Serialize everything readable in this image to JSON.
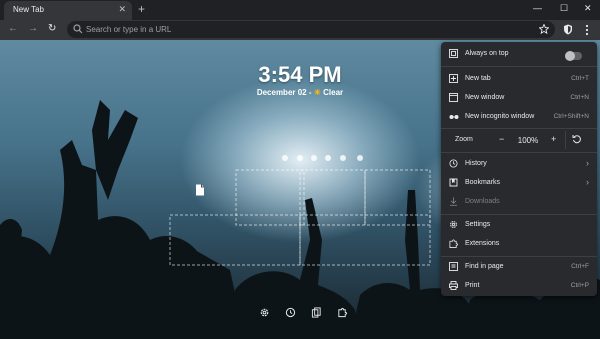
{
  "tab": {
    "title": "New Tab",
    "close": "✕"
  },
  "new_tab_button": "+",
  "window": {
    "minimize": "—",
    "maximize": "☐",
    "close": "✕"
  },
  "nav": {
    "back": "←",
    "forward": "→",
    "reload": "↻"
  },
  "omnibox": {
    "placeholder": "Search or type in a URL"
  },
  "newtab_page": {
    "time": "3:54 PM",
    "date": "December 02 -",
    "weather_icon": "☀",
    "weather": "Clear"
  },
  "menu": {
    "always_on_top": {
      "label": "Always on top",
      "enabled": false
    },
    "new_tab": {
      "label": "New tab",
      "shortcut": "Ctrl+T"
    },
    "new_window": {
      "label": "New window",
      "shortcut": "Ctrl+N"
    },
    "new_incognito": {
      "label": "New incognito window",
      "shortcut": "Ctrl+Shift+N"
    },
    "zoom": {
      "label": "Zoom",
      "minus": "−",
      "value": "100%",
      "plus": "+"
    },
    "history": {
      "label": "History",
      "arrow": "›"
    },
    "bookmarks": {
      "label": "Bookmarks",
      "arrow": "›"
    },
    "downloads": {
      "label": "Downloads"
    },
    "settings": {
      "label": "Settings"
    },
    "extensions": {
      "label": "Extensions"
    },
    "find": {
      "label": "Find in page",
      "shortcut": "Ctrl+F"
    },
    "print": {
      "label": "Print",
      "shortcut": "Ctrl+P"
    }
  },
  "colors": {
    "accent": "#fbbc04",
    "menu_bg": "#292a2d",
    "toolbar": "#35363a"
  }
}
